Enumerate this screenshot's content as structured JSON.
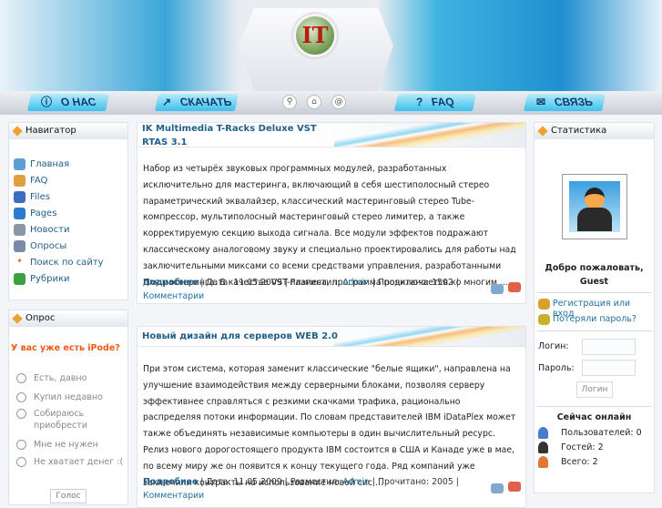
{
  "header": {
    "logo_text": "IT"
  },
  "nav": {
    "items": [
      {
        "label": "О НАС",
        "icon": "info-icon"
      },
      {
        "label": "СКАЧАТЬ",
        "icon": "download-icon"
      },
      {
        "label": "FAQ",
        "icon": "question-icon"
      },
      {
        "label": "СВЯЗЬ",
        "icon": "mail-icon"
      }
    ],
    "icons": [
      "search-icon",
      "home-icon",
      "at-icon"
    ]
  },
  "navigator": {
    "title": "Навигатор",
    "items": [
      "Главная",
      "FAQ",
      "Files",
      "Pages",
      "Новости",
      "Опросы",
      "Поиск по сайту",
      "Рубрики"
    ]
  },
  "poll": {
    "title": "Опрос",
    "question": "У вас уже есть iPode?",
    "options": [
      "Есть, давно",
      "Купил недавно",
      "Собираюсь приобрести",
      "Мне не нужен",
      "Не хватает денег :("
    ],
    "vote": "Голос"
  },
  "articles": [
    {
      "title": "IK Multimedia T-Racks Deluxe VST RTAS 3.1",
      "text": "Набор из четырёх звуковых программных модулей, разработанных исключительно для мастеринга, включающий в себя шестиполосный стерео параметрический эквалайзер, классический мастеринговый стерео Tube-компрессор, мультиполосный мастеринговый стерео лимитер, а также корректируемую секцию выхода сигнала. Все модули эффектов подражают классическому аналоговому звуку и специально проектировались для работы над заключительными миксами со всеми средствами управления, разработанными для мастеринга. В качестве VST-плагина, программа подключается ко многим ...",
      "more": "Подробнее",
      "date": " | Дата: 11.05.2009 | Разместил: ",
      "author": "Admin",
      "reads": " | Прочитано: 1502 | ",
      "comments": "Комментарии"
    },
    {
      "title": "Новый дизайн для серверов WEB 2.0",
      "text": "При этом система, которая заменит классические \"белые ящики\", направлена на улучшение взаимодействия между серверными блоками, позволяя серверу эффективнее справляться с резкими скачками трафика, рационально распределяя потоки информации. По словам представителей IBM iDataPlex может также объединять независимые компьютеры в один вычислительный ресурс. Релиз нового дорогостоящего продукта IBM состоится в США и Канаде уже в мае, по всему миру же он появится к концу текущего года. Ряд компаний уже заключили контракты на использование новой сис ...",
      "more": "Подробнее",
      "date": " | Дата: 11.05.2009 | Разместил: ",
      "author": "Admin",
      "reads": " | Прочитано: 2005 | ",
      "comments": "Комментарии"
    }
  ],
  "stats": {
    "title": "Статистика",
    "welcome": "Добро пожаловать, Guest",
    "register": "Регистрация или вход",
    "lost": "Потеряли пароль?",
    "login_label": "Логин:",
    "password_label": "Пароль:",
    "login_button": "Логин",
    "online_title": "Сейчас онлайн",
    "users": "Пользователей: 0",
    "guests": "Гостей: 2",
    "total": "Всего: 2"
  }
}
